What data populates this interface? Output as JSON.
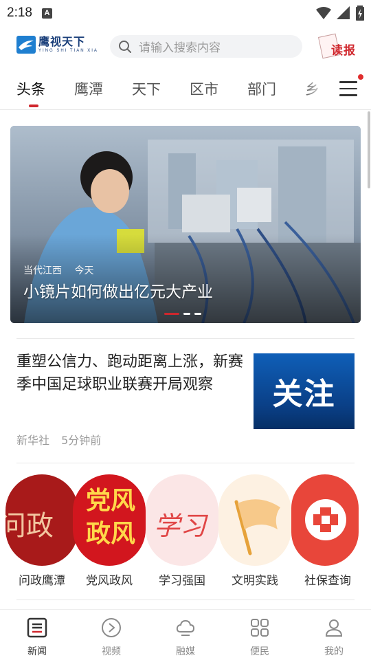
{
  "status_bar": {
    "time": "2:18",
    "notification_letter": "A"
  },
  "header": {
    "logo_cn": "鹰视天下",
    "logo_en": "YING SHI TIAN XIA",
    "search_placeholder": "请输入搜索内容",
    "read_label": "读报"
  },
  "tabs": [
    {
      "label": "头条",
      "active": true
    },
    {
      "label": "鹰潭",
      "active": false
    },
    {
      "label": "天下",
      "active": false
    },
    {
      "label": "区市",
      "active": false
    },
    {
      "label": "部门",
      "active": false
    },
    {
      "label": "乡",
      "active": false
    }
  ],
  "banner": {
    "source": "当代江西",
    "time": "今天",
    "title": "小镜片如何做出亿元大产业",
    "slide_count": 3,
    "active_slide": 1
  },
  "article": {
    "title": "重塑公信力、跑动距离上涨，新赛季中国足球职业联赛开局观察",
    "source": "新华社",
    "time": "5分钟前",
    "thumb_text": "关注"
  },
  "shortcuts": [
    {
      "label": "问政鹰潭",
      "image_text": "问政"
    },
    {
      "label": "党风政风",
      "image_text": "党风政风"
    },
    {
      "label": "学习强国",
      "image_text": "学习"
    },
    {
      "label": "文明实践",
      "icon": "flag-icon"
    },
    {
      "label": "社保查询",
      "icon": "medical-cross-icon"
    }
  ],
  "bottom_nav": [
    {
      "label": "新闻",
      "icon": "news-icon",
      "active": true
    },
    {
      "label": "视频",
      "icon": "play-icon",
      "active": false
    },
    {
      "label": "融媒",
      "icon": "cloud-icon",
      "active": false
    },
    {
      "label": "便民",
      "icon": "grid-icon",
      "active": false
    },
    {
      "label": "我的",
      "icon": "user-icon",
      "active": false
    }
  ],
  "colors": {
    "accent": "#d0272d",
    "logo_blue": "#1f7fd0",
    "search_bg": "#f2f3f5",
    "notification_dot": "#e02d2d"
  }
}
